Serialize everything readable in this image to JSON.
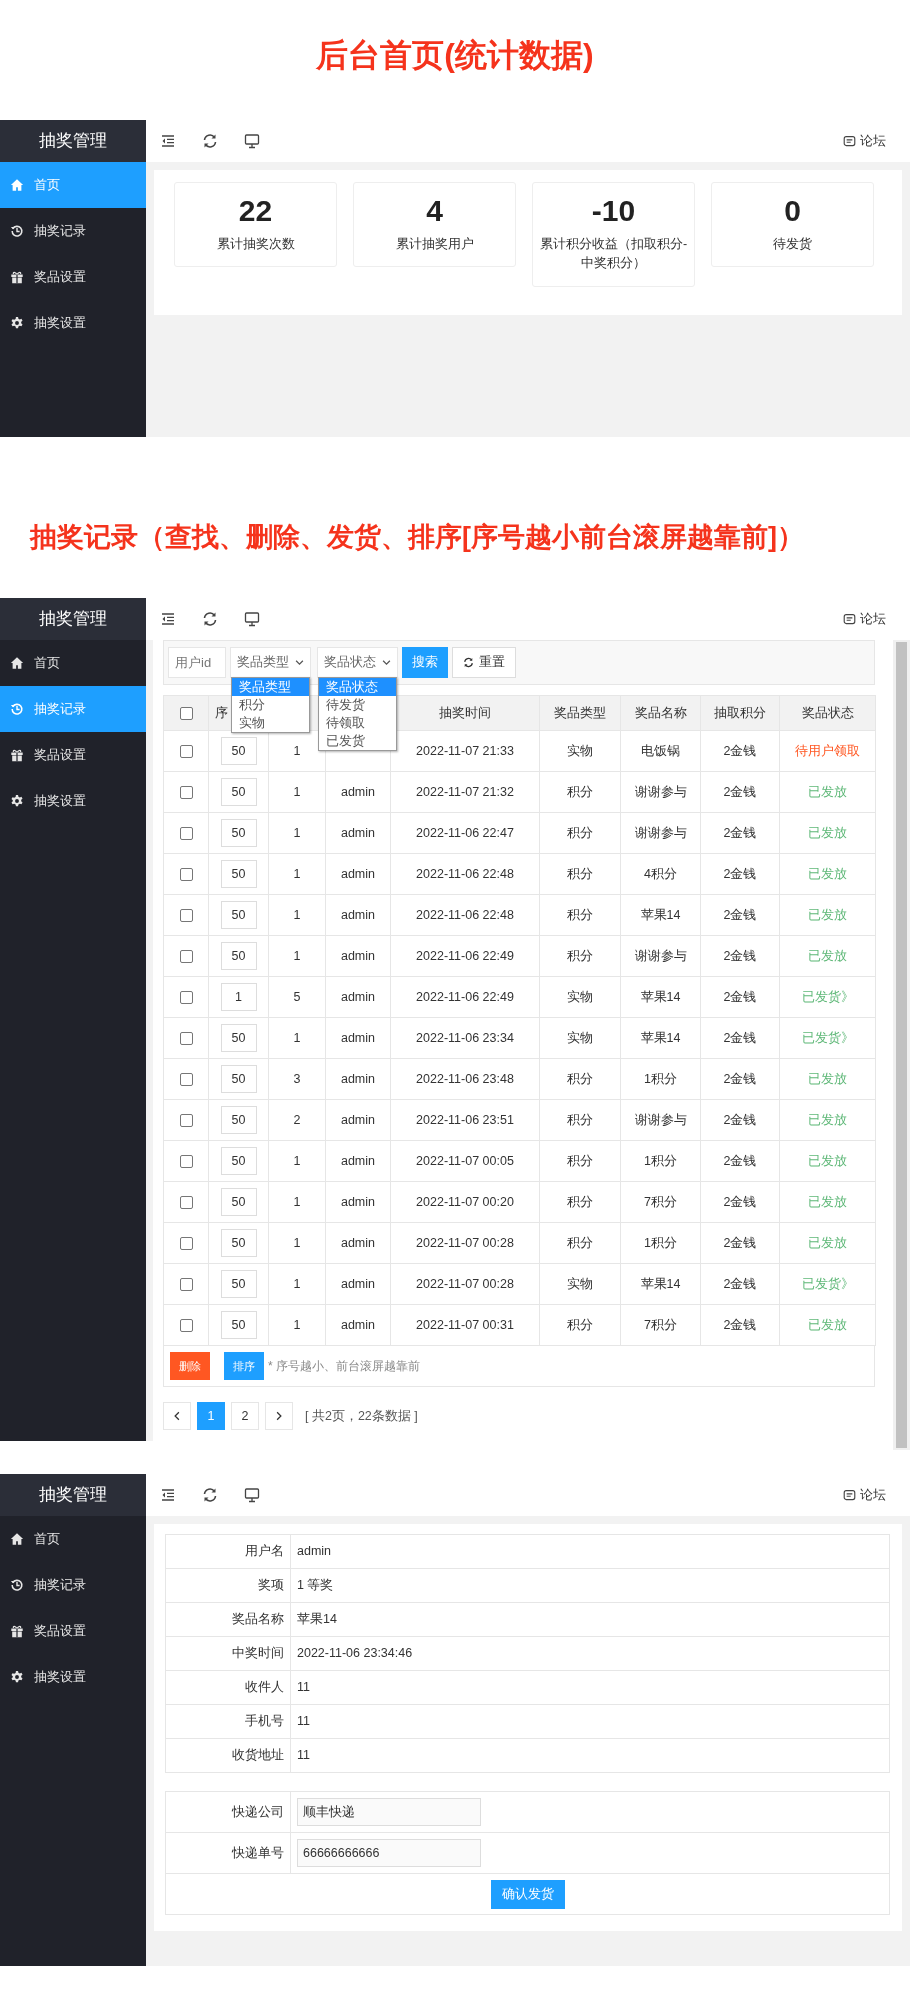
{
  "screen_1": {
    "heading": "后台首页(统计数据)",
    "brand": "抽奖管理",
    "nav": [
      {
        "kind": "home",
        "label": "首页",
        "selected": true
      },
      {
        "kind": "history",
        "label": "抽奖记录",
        "selected": false
      },
      {
        "kind": "gift",
        "label": "奖品设置",
        "selected": false
      },
      {
        "kind": "gear",
        "label": "抽奖设置",
        "selected": false
      }
    ],
    "topbar_link": "论坛",
    "stats": [
      {
        "value": "22",
        "label": "累计抽奖次数"
      },
      {
        "value": "4",
        "label": "累计抽奖用户"
      },
      {
        "value": "-10",
        "label": "累计积分收益（扣取积分-中奖积分）"
      },
      {
        "value": "0",
        "label": "待发货"
      }
    ]
  },
  "screen_2": {
    "heading": "抽奖记录（查找、删除、发货、排序[序号越小前台滚屏越靠前]）",
    "brand": "抽奖管理",
    "nav": [
      {
        "kind": "home",
        "label": "首页",
        "selected": false
      },
      {
        "kind": "history",
        "label": "抽奖记录",
        "selected": true
      },
      {
        "kind": "gift",
        "label": "奖品设置",
        "selected": false
      },
      {
        "kind": "gear",
        "label": "抽奖设置",
        "selected": false
      }
    ],
    "topbar_link": "论坛",
    "filters": {
      "user_id": {
        "placeholder": "用户id"
      },
      "type_select": {
        "value": "奖品类型",
        "expanded": true,
        "options": [
          {
            "label": "奖品类型",
            "selected": true
          },
          {
            "label": "积分",
            "selected": false
          },
          {
            "label": "实物",
            "selected": false
          }
        ]
      },
      "status_select": {
        "value": "奖品状态",
        "expanded": true,
        "options": [
          {
            "label": "奖品状态",
            "selected": true
          },
          {
            "label": "待发货",
            "selected": false
          },
          {
            "label": "待领取",
            "selected": false
          },
          {
            "label": "已发货",
            "selected": false
          }
        ]
      },
      "search_button": "搜索",
      "reset_button": "重置"
    },
    "select_all": {
      "checked": false
    },
    "columns": [
      "序",
      "抽奖时间",
      "奖品类型",
      "奖品名称",
      "抽取积分",
      "奖品状态"
    ],
    "rows": [
      {
        "checked": false,
        "order": "50",
        "level": "1",
        "time": "2022-11-07 21:33",
        "type": "实物",
        "name": "电饭锅",
        "cost": "2金钱",
        "status": "待用户领取",
        "color": "#ff5722"
      },
      {
        "checked": false,
        "order": "50",
        "level": "1",
        "user": "admin",
        "time": "2022-11-07 21:32",
        "type": "积分",
        "name": "谢谢参与",
        "cost": "2金钱",
        "status": "已发放",
        "color": "#5fb878"
      },
      {
        "checked": false,
        "order": "50",
        "level": "1",
        "user": "admin",
        "time": "2022-11-06 22:47",
        "type": "积分",
        "name": "谢谢参与",
        "cost": "2金钱",
        "status": "已发放",
        "color": "#5fb878"
      },
      {
        "checked": false,
        "order": "50",
        "level": "1",
        "user": "admin",
        "time": "2022-11-06 22:48",
        "type": "积分",
        "name": "4积分",
        "cost": "2金钱",
        "status": "已发放",
        "color": "#5fb878"
      },
      {
        "checked": false,
        "order": "50",
        "level": "1",
        "user": "admin",
        "time": "2022-11-06 22:48",
        "type": "积分",
        "name": "苹果14",
        "cost": "2金钱",
        "status": "已发放",
        "color": "#5fb878"
      },
      {
        "checked": false,
        "order": "50",
        "level": "1",
        "user": "admin",
        "time": "2022-11-06 22:49",
        "type": "积分",
        "name": "谢谢参与",
        "cost": "2金钱",
        "status": "已发放",
        "color": "#5fb878"
      },
      {
        "checked": false,
        "order": "1",
        "level": "5",
        "user": "admin",
        "time": "2022-11-06 22:49",
        "type": "实物",
        "name": "苹果14",
        "cost": "2金钱",
        "status": "已发货》",
        "color": "#5fb878"
      },
      {
        "checked": false,
        "order": "50",
        "level": "1",
        "user": "admin",
        "time": "2022-11-06 23:34",
        "type": "实物",
        "name": "苹果14",
        "cost": "2金钱",
        "status": "已发货》",
        "color": "#5fb878"
      },
      {
        "checked": false,
        "order": "50",
        "level": "3",
        "user": "admin",
        "time": "2022-11-06 23:48",
        "type": "积分",
        "name": "1积分",
        "cost": "2金钱",
        "status": "已发放",
        "color": "#5fb878"
      },
      {
        "checked": false,
        "order": "50",
        "level": "2",
        "user": "admin",
        "time": "2022-11-06 23:51",
        "type": "积分",
        "name": "谢谢参与",
        "cost": "2金钱",
        "status": "已发放",
        "color": "#5fb878"
      },
      {
        "checked": false,
        "order": "50",
        "level": "1",
        "user": "admin",
        "time": "2022-11-07 00:05",
        "type": "积分",
        "name": "1积分",
        "cost": "2金钱",
        "status": "已发放",
        "color": "#5fb878"
      },
      {
        "checked": false,
        "order": "50",
        "level": "1",
        "user": "admin",
        "time": "2022-11-07 00:20",
        "type": "积分",
        "name": "7积分",
        "cost": "2金钱",
        "status": "已发放",
        "color": "#5fb878"
      },
      {
        "checked": false,
        "order": "50",
        "level": "1",
        "user": "admin",
        "time": "2022-11-07 00:28",
        "type": "积分",
        "name": "1积分",
        "cost": "2金钱",
        "status": "已发放",
        "color": "#5fb878"
      },
      {
        "checked": false,
        "order": "50",
        "level": "1",
        "user": "admin",
        "time": "2022-11-07 00:28",
        "type": "实物",
        "name": "苹果14",
        "cost": "2金钱",
        "status": "已发货》",
        "color": "#5fb878"
      },
      {
        "checked": false,
        "order": "50",
        "level": "1",
        "user": "admin",
        "time": "2022-11-07 00:31",
        "type": "积分",
        "name": "7积分",
        "cost": "2金钱",
        "status": "已发放",
        "color": "#5fb878"
      }
    ],
    "delete_button": "删除",
    "sort_button": "排序",
    "sort_note": "* 序号越小、前台滚屏越靠前",
    "pages": [
      {
        "label": "1",
        "selected": true
      },
      {
        "label": "2",
        "selected": false
      }
    ],
    "page_summary": "[ 共2页，22条数据 ]"
  },
  "screen_3": {
    "brand": "抽奖管理",
    "nav": [
      {
        "kind": "home",
        "label": "首页",
        "selected": false
      },
      {
        "kind": "history",
        "label": "抽奖记录",
        "selected": false
      },
      {
        "kind": "gift",
        "label": "奖品设置",
        "selected": false
      },
      {
        "kind": "gear",
        "label": "抽奖设置",
        "selected": false
      }
    ],
    "topbar_link": "论坛",
    "details": [
      {
        "label": "用户名",
        "value": "admin"
      },
      {
        "label": "奖项",
        "value": "1 等奖"
      },
      {
        "label": "奖品名称",
        "value": "苹果14"
      },
      {
        "label": "中奖时间",
        "value": "2022-11-06 23:34:46"
      },
      {
        "label": "收件人",
        "value": "11"
      },
      {
        "label": "手机号",
        "value": "11"
      },
      {
        "label": "收货地址",
        "value": "11"
      }
    ],
    "shipping": [
      {
        "label": "快递公司",
        "value": "顺丰快递"
      },
      {
        "label": "快递单号",
        "value": "66666666666"
      }
    ],
    "confirm_button": "确认发货"
  }
}
